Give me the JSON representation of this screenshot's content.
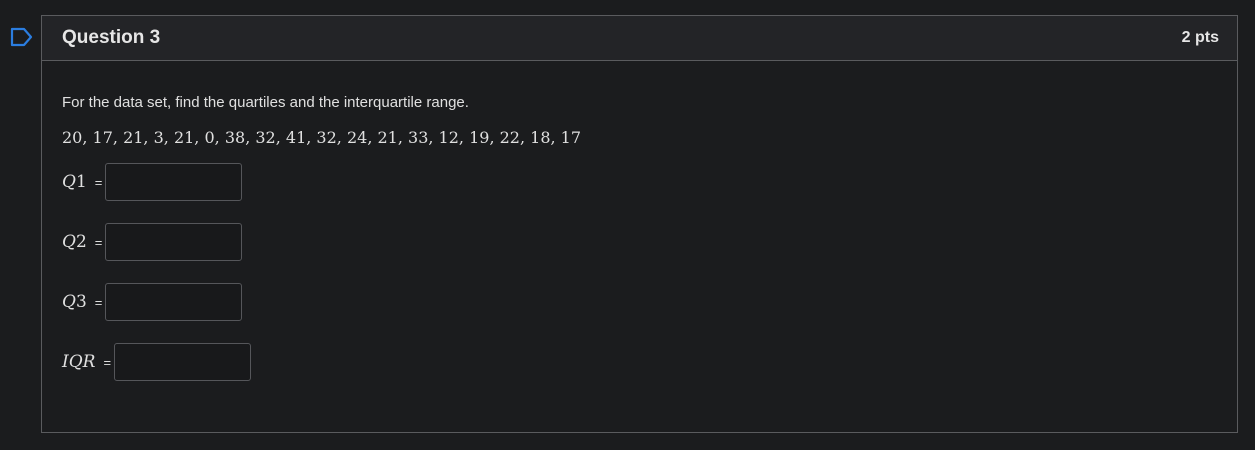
{
  "question": {
    "title": "Question 3",
    "points": "2 pts",
    "prompt": "For  the data set, find the quartiles and the interquartile range.",
    "dataset": "20, 17, 21, 3, 21, 0, 38, 32, 41, 32, 24, 21, 33, 12, 19, 22, 18, 17"
  },
  "answers": [
    {
      "var": "Q",
      "sub": "1",
      "equals": "=",
      "value": ""
    },
    {
      "var": "Q",
      "sub": "2",
      "equals": "=",
      "value": ""
    },
    {
      "var": "Q",
      "sub": "3",
      "equals": "=",
      "value": ""
    },
    {
      "var": "IQR",
      "sub": "",
      "equals": "=",
      "value": ""
    }
  ],
  "icons": {
    "flag": "flag-outline-icon"
  },
  "colors": {
    "background": "#1b1c1e",
    "header": "#232427",
    "border": "#5a5b5e",
    "flag": "#2b7de0"
  }
}
